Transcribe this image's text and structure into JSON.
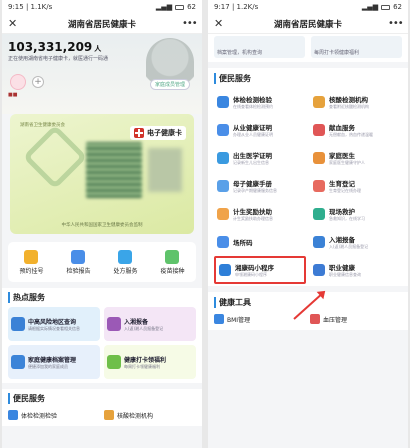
{
  "left": {
    "status": {
      "time": "9:15",
      "speed": "1.1K/s",
      "battery": "62"
    },
    "title": "湖南省居民健康卡",
    "hero": {
      "count": "103,331,209",
      "unit": "人",
      "subtitle": "正在使用湖南省电子健康卡，就医通行一码通",
      "family_label": "家庭成员管理",
      "plus": "+"
    },
    "card": {
      "org": "湖南省卫生健康委员会",
      "badge": "电子健康卡",
      "ministry": "中华人民共和国国家卫生健康委员会监制"
    },
    "quick": [
      {
        "label": "预约挂号",
        "color": "#f2b12d"
      },
      {
        "label": "检验报告",
        "color": "#4a8ee8"
      },
      {
        "label": "处方服务",
        "color": "#3aa5e8"
      },
      {
        "label": "疫苗接种",
        "color": "#5fc36b"
      }
    ],
    "hot": {
      "title": "热点服务",
      "items": [
        {
          "t": "中高风险地区查询",
          "s": "请根据实际情况查看相关信息",
          "bg": "#e1f0fb",
          "ic": "#3b82d6"
        },
        {
          "t": "入湘报备",
          "s": "入(返)湘人员报备登记",
          "bg": "#f4e6f6",
          "ic": "#9b59b6"
        },
        {
          "t": "家庭健康档案管理",
          "s": "便捷添加我的家庭成员",
          "bg": "#e7f0fb",
          "ic": "#3c84d8"
        },
        {
          "t": "健康打卡领福利",
          "s": "每周打卡领健康福利",
          "bg": "#f6fbe6",
          "ic": "#6fbf4a"
        }
      ]
    },
    "svc": {
      "title": "便民服务",
      "items": [
        {
          "t": "体检检测检验",
          "ic": "#3a86e0"
        },
        {
          "t": "核酸检测机构",
          "ic": "#e6a23c"
        }
      ]
    }
  },
  "right": {
    "status": {
      "time": "9:17",
      "speed": "1.2K/s",
      "battery": "62"
    },
    "title": "湖南省居民健康卡",
    "top": [
      {
        "t": "档案管理，机构查询"
      },
      {
        "t": "每周打卡领健康福利"
      }
    ],
    "svc": {
      "title": "便民服务",
      "items": [
        {
          "t": "体检检测检验",
          "s": "在线查看体检检测预约",
          "ic": "#3a86e0"
        },
        {
          "t": "核酸检测机构",
          "s": "查看附近核酸检测机构",
          "ic": "#e6a23c"
        },
        {
          "t": "从业健康证明",
          "s": "办理从业人员健康证明",
          "ic": "#4a8ee8"
        },
        {
          "t": "献血服务",
          "s": "无偿献血，热血传递温暖",
          "ic": "#e05656"
        },
        {
          "t": "出生医学证明",
          "s": "记录新生儿出生信息",
          "ic": "#3a9ae0"
        },
        {
          "t": "家庭医生",
          "s": "家庭医生健康守护人",
          "ic": "#e8913a"
        },
        {
          "t": "母子健康手册",
          "s": "记录孕产期健康服务信息",
          "ic": "#5aa0e8"
        },
        {
          "t": "生育登记",
          "s": "生育登记在线办理",
          "ic": "#e76a5f"
        },
        {
          "t": "计生奖励扶助",
          "s": "计生奖励扶助办理信息",
          "ic": "#f0a34a"
        },
        {
          "t": "现场救护",
          "s": "急救知识，在线学习",
          "ic": "#2fae8e"
        },
        {
          "t": "场所码",
          "s": "",
          "ic": "#4a8ee8"
        },
        {
          "t": "入湘报备",
          "s": "入(返)湘人员报备登记",
          "ic": "#3b82d6"
        },
        {
          "t": "湘康码小程序",
          "s": "申领湘康码小程序",
          "ic": "#2e7fd8",
          "highlight": true
        },
        {
          "t": "职业健康",
          "s": "职业健康信息查询",
          "ic": "#3d7bd4"
        }
      ]
    },
    "tools": {
      "title": "健康工具",
      "items": [
        {
          "t": "BMI管理",
          "ic": "#3a86e0"
        },
        {
          "t": "血压管理",
          "ic": "#e05656"
        }
      ]
    }
  }
}
